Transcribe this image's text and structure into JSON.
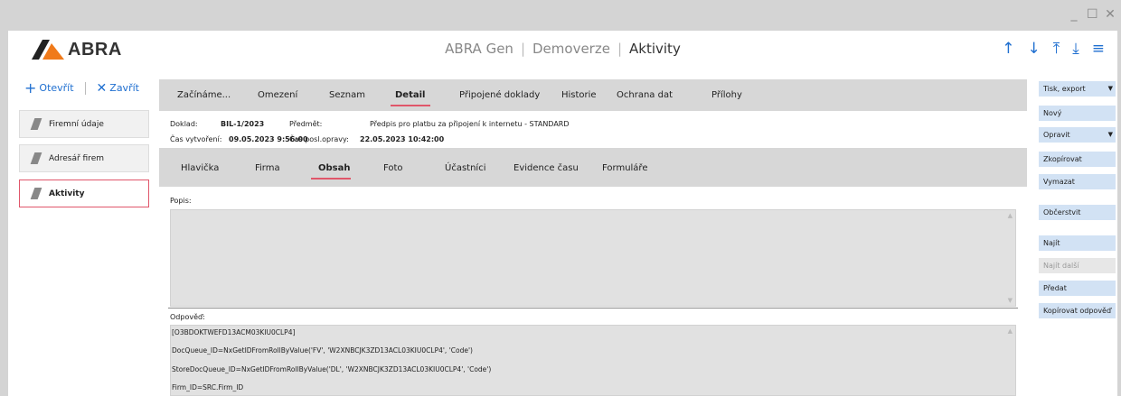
{
  "window": {
    "min": "_",
    "max": "☐",
    "close": "✕"
  },
  "header": {
    "logo_text": "ABRA",
    "title_parts": [
      "ABRA Gen",
      "Demoverze",
      "Aktivity"
    ],
    "separator": "|",
    "nav": [
      "↑",
      "↓",
      "⤒",
      "⤓",
      "≡"
    ]
  },
  "left": {
    "open": "Otevřít",
    "close": "Zavřít",
    "modules": [
      "Firemní údaje",
      "Adresář firem",
      "Aktivity"
    ]
  },
  "tabs": [
    "Začínáme...",
    "Omezení",
    "Seznam",
    "Detail",
    "Připojené doklady",
    "Historie",
    "Ochrana dat",
    "Přílohy"
  ],
  "doc": {
    "doklad_label": "Doklad:",
    "doklad_value": "BIL-1/2023",
    "predmet_label": "Předmět:",
    "predmet_value": "Předpis pro platbu za připojení k internetu - STANDARD",
    "created_label": "Čas vytvoření:",
    "created_value": "09.05.2023 9:56:00",
    "modified_label": "Čas posl.opravy:",
    "modified_value": "22.05.2023 10:42:00"
  },
  "subtabs": [
    "Hlavička",
    "Firma",
    "Obsah",
    "Foto",
    "Účastníci",
    "Evidence času",
    "Formuláře"
  ],
  "content": {
    "popis_label": "Popis:",
    "odpoved_label": "Odpověď:",
    "odpoved_lines": [
      "[O3BDOKTWEFD13ACM03KIU0CLP4]",
      "DocQueue_ID=NxGetIDFromRollByValue('FV', 'W2XNBCJK3ZD13ACL03KIU0CLP4', 'Code')",
      "StoreDocQueue_ID=NxGetIDFromRollByValue('DL', 'W2XNBCJK3ZD13ACL03KIU0CLP4', 'Code')",
      "Firm_ID=SRC.Firm_ID"
    ]
  },
  "right": {
    "buttons": [
      "Tisk, export",
      "Nový",
      "Opravit",
      "Zkopírovat",
      "Vymazat",
      "Občerstvit",
      "Najít",
      "Najít další",
      "Předat",
      "Kopírovat odpověď"
    ]
  },
  "colors": {
    "accent": "#e0566a",
    "link": "#1f6fd0",
    "button_bg": "#d2e2f4"
  }
}
